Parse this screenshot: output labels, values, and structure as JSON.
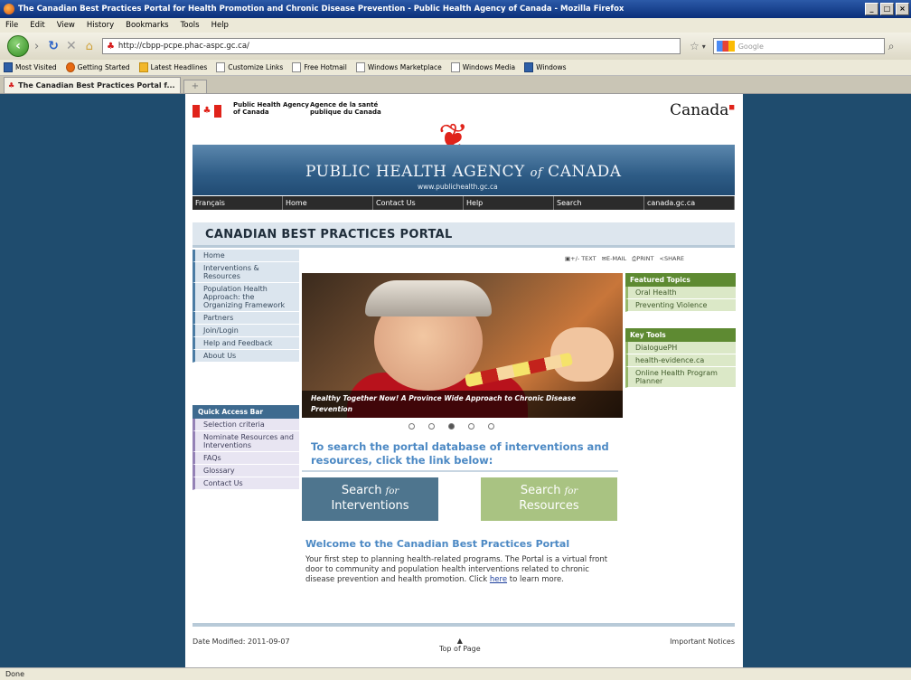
{
  "browser": {
    "window_title": "The Canadian Best Practices Portal for Health Promotion and Chronic Disease Prevention - Public Health Agency of Canada - Mozilla Firefox",
    "menu": [
      "File",
      "Edit",
      "View",
      "History",
      "Bookmarks",
      "Tools",
      "Help"
    ],
    "url": "http://cbpp-pcpe.phac-aspc.gc.ca/",
    "search_placeholder": "Google",
    "bookmarks": [
      "Most Visited",
      "Getting Started",
      "Latest Headlines",
      "Customize Links",
      "Free Hotmail",
      "Windows Marketplace",
      "Windows Media",
      "Windows"
    ],
    "tab_title": "The Canadian Best Practices Portal f...",
    "new_tab": "+",
    "status": "Done",
    "window_buttons": [
      "_",
      "□",
      "×"
    ]
  },
  "header": {
    "phac_en": "Public Health Agency of Canada",
    "phac_fr": "Agence de la santé publique du Canada",
    "wordmark": "Canada",
    "banner_title_1": "PUBLIC HEALTH AGENCY ",
    "banner_of": "of",
    "banner_title_2": " CANADA",
    "banner_url": "www.publichealth.gc.ca",
    "nav": [
      "Français",
      "Home",
      "Contact Us",
      "Help",
      "Search",
      "canada.gc.ca"
    ]
  },
  "portal_title": "CANADIAN BEST PRACTICES PORTAL",
  "left_nav": [
    "Home",
    "Interventions & Resources",
    "Population Health Approach: the Organizing Framework",
    "Partners",
    "Join/Login",
    "Help and Feedback",
    "About Us"
  ],
  "quick_access": {
    "heading": "Quick Access Bar",
    "items": [
      "Selection criteria",
      "Nominate Resources and Interventions",
      "FAQs",
      "Glossary",
      "Contact Us"
    ]
  },
  "tools": [
    "+/- TEXT",
    "E-MAIL",
    "PRINT",
    "SHARE"
  ],
  "carousel": {
    "caption_bold": "Healthy Together Now!",
    "caption_rest": " A Province Wide Approach to Chronic Disease Prevention",
    "active_slide": 3,
    "slide_count": 5
  },
  "featured_topics": {
    "heading": "Featured Topics",
    "items": [
      "Oral Health",
      "Preventing Violence"
    ]
  },
  "key_tools": {
    "heading": "Key Tools",
    "items": [
      "DialoguePH",
      "health-evidence.ca",
      "Online Health Program Planner"
    ]
  },
  "search_prompt": "To search the portal database of interventions and resources, click the link below:",
  "buttons": {
    "search": "Search",
    "for": "for",
    "interventions": "Interventions",
    "resources": "Resources"
  },
  "welcome": {
    "title": "Welcome to the Canadian Best Practices Portal",
    "text_before": "Your first step to planning health-related programs. The Portal is a virtual front door to community and population health interventions related to chronic disease prevention and health promotion. Click ",
    "link": "here",
    "text_after": " to learn more."
  },
  "footer": {
    "date_modified": "Date Modified: 2011-09-07",
    "top_of_page": "Top of Page",
    "notices": "Important Notices"
  }
}
